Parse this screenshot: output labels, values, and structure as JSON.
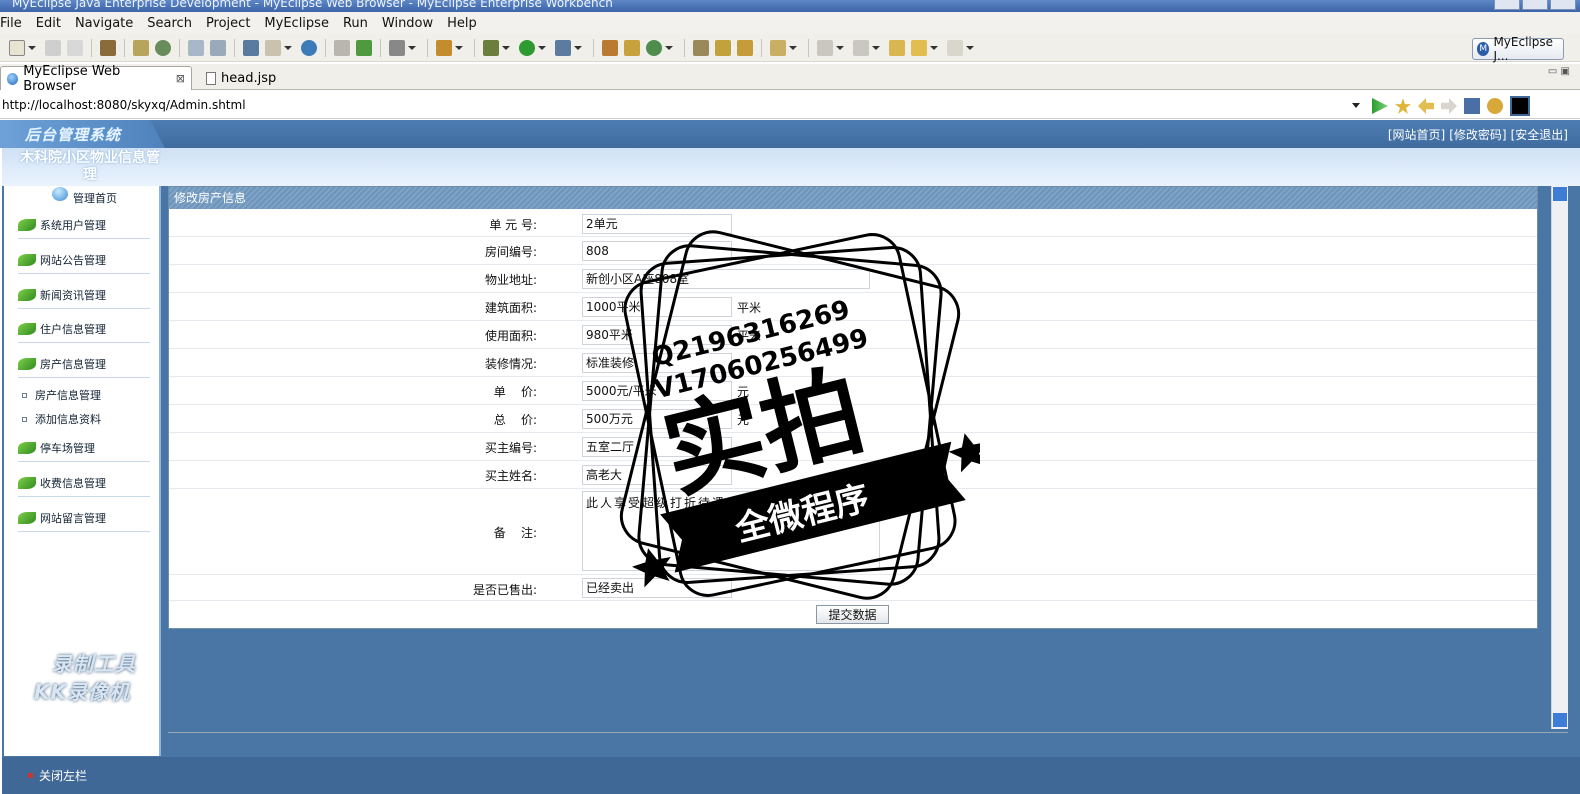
{
  "window": {
    "title": "MyEclipse Java Enterprise Development - MyEclipse Web Browser - MyEclipse Enterprise Workbench"
  },
  "menu": [
    "File",
    "Edit",
    "Navigate",
    "Search",
    "Project",
    "MyEclipse",
    "Run",
    "Window",
    "Help"
  ],
  "perspective": {
    "label": "MyEclipse J...",
    "icon": "myeclipse-icon"
  },
  "tabs": [
    {
      "label": "MyEclipse Web Browser",
      "icon": "globe-icon",
      "close": "⊠"
    },
    {
      "label": "head.jsp",
      "icon": "jsp-file-icon"
    }
  ],
  "browser": {
    "url": "http://localhost:8080/skyxq/Admin.shtml"
  },
  "header": {
    "logo": "后台管理系统",
    "links": [
      "[网站首页]",
      "[修改密码]",
      "[安全退出]"
    ]
  },
  "site": {
    "name": "木科院小区物业信息管\n理"
  },
  "sidebar": {
    "home": "管理首页",
    "items": [
      "系统用户管理",
      "网站公告管理",
      "新闻资讯管理",
      "住户信息管理",
      "房产信息管理"
    ],
    "subitems": [
      "房产信息管理",
      "添加信息资料"
    ],
    "items2": [
      "停车场管理",
      "收费信息管理",
      "网站留言管理"
    ]
  },
  "form": {
    "title": "修改房产信息",
    "fields": [
      {
        "label": "单 元 号:",
        "value": "2单元"
      },
      {
        "label": "房间编号:",
        "value": "808"
      },
      {
        "label": "物业地址:",
        "value": "新创小区A座808室"
      },
      {
        "label": "建筑面积:",
        "value": "1000平米",
        "unit": "平米"
      },
      {
        "label": "使用面积:",
        "value": "980平米",
        "unit": "平米"
      },
      {
        "label": "装修情况:",
        "value": "标准装修"
      },
      {
        "label": "单    价:",
        "value": "5000元/平米",
        "unit": "元"
      },
      {
        "label": "总    价:",
        "value": "500万元",
        "unit": "元"
      },
      {
        "label": "买主编号:",
        "value": "五室二厅"
      },
      {
        "label": "买主姓名:",
        "value": "高老大"
      }
    ],
    "remark_label": "备    注:",
    "remark_value": "此人享受超级打折待遇",
    "sold_label": "是否已售出:",
    "sold_value": "已经卖出",
    "submit": "提交数据"
  },
  "footer": {
    "close_left": "关闭左栏"
  },
  "watermark": {
    "line1": "录制工具",
    "line2": "KK录像机"
  },
  "stamp": {
    "qq": "Q2196316269",
    "v": "V17060256499",
    "main": "实拍",
    "ribbon": "全微程序"
  }
}
